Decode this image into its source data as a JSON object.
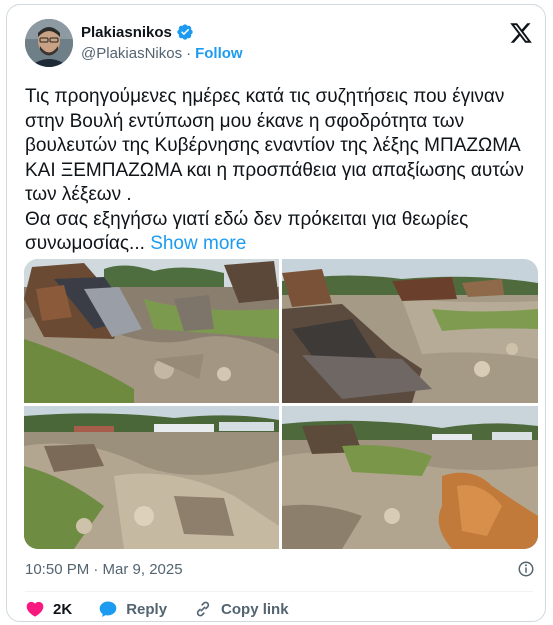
{
  "user": {
    "name": "Plakiasnikos",
    "handle": "@PlakiasNikos",
    "separator": "·",
    "follow_label": "Follow"
  },
  "tweet": {
    "text": "Τις προηγούμενες ημέρες κατά τις συζητήσεις που έγιναν στην Βουλή εντύπωση μου έκανε η σφοδρότητα των βουλευτών της Κυβέρνησης εναντίον της λέξης ΜΠΑΖΩΜΑ ΚΑΙ ΞΕΜΠΑΖΩΜΑ και η προσπάθεια για απαξίωσης αυτών των λέξεων .\nΘα σας εξηγήσω γιατί εδώ δεν πρόκειται για θεωρίες συνωμοσίας...",
    "show_more_label": "Show more"
  },
  "meta": {
    "timestamp": "10:50 PM · Mar 9, 2025"
  },
  "actions": {
    "likes_count": "2K",
    "reply_label": "Reply",
    "copy_link_label": "Copy link"
  },
  "icons": {
    "verified": "verified-badge-icon",
    "logo": "x-logo-icon",
    "info": "info-icon",
    "like": "heart-icon",
    "reply": "reply-icon",
    "copy": "link-icon"
  },
  "colors": {
    "accent": "#1d9bf0",
    "like": "#f91880",
    "muted": "#536471"
  }
}
